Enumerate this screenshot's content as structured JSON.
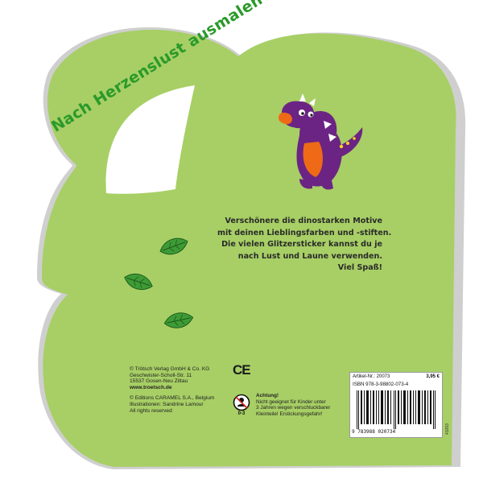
{
  "colors": {
    "cover_green": "#a7cf65",
    "cover_edge": "#c9c9c9",
    "headline_green": "#2a9a2a",
    "dino_purple": "#6b2483",
    "dino_orange": "#ef6a16"
  },
  "cover": {
    "headline": "Nach Herzenslust ausmalen",
    "intro_lines": [
      "Verschönere die dinostarken Motive",
      "mit deinen Lieblingsfarben und -stiften.",
      "Die vielen Glitzersticker kannst du je",
      "nach Lust und Laune verwenden.",
      "Viel Spaß!"
    ],
    "illustration": "purple-dinosaur-icon",
    "leaves": "leaf-icon"
  },
  "imprint": {
    "publisher": "© Trötsch Verlag GmbH & Co. KG",
    "street": "Geschwister-Scholl-Str. 11",
    "city": "15537 Gosen-Neu Zittau",
    "web": "www.troetsch.de",
    "editions": "© Editions CARAMEL S.A., Belgium",
    "illustrations": "Illustrationen: Sandrine Lamour",
    "rights": "All rights reserved"
  },
  "ce_mark": "CE",
  "age_warning": {
    "age": "0-3",
    "title": "Achtung!",
    "lines": [
      "Nicht geeignet für Kinder unter",
      "3 Jahren wegen verschluckbarer",
      "Kleinteile! Erstickungsgefahr!"
    ]
  },
  "product_label": {
    "article": "Artikel-Nr.: 20073",
    "price": "3,95 €",
    "isbn": "ISBN 978-3-98802-073-4",
    "ean": "9  783988  020734",
    "side_code": "41053"
  }
}
